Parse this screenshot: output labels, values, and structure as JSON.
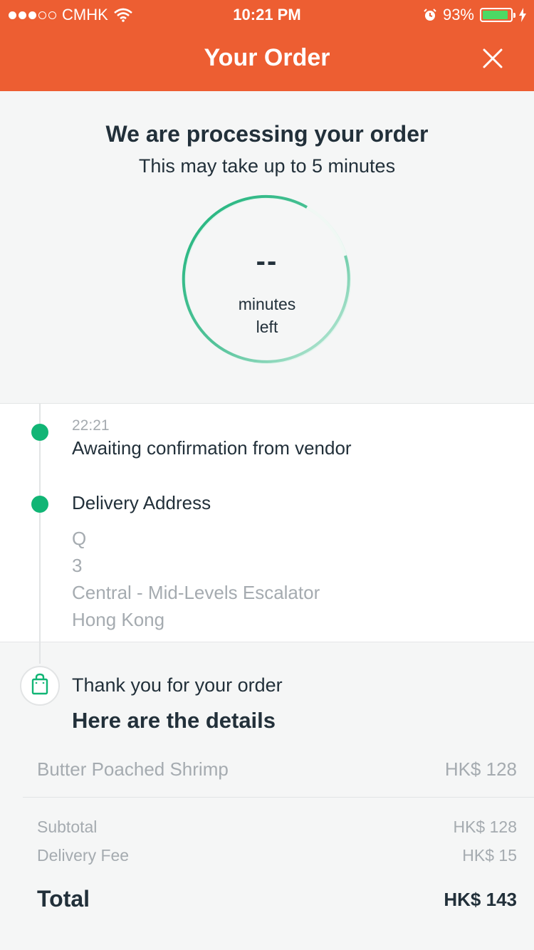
{
  "status_bar": {
    "carrier": "CMHK",
    "time": "10:21 PM",
    "battery_percent": "93%",
    "battery_level": 0.93,
    "signal_bars": 3,
    "signal_total": 5
  },
  "header": {
    "title": "Your Order",
    "background": "#ed5e32"
  },
  "processing": {
    "title": "We are processing your order",
    "subtitle": "This may take up to 5 minutes",
    "countdown_value": "--",
    "countdown_label_line1": "minutes",
    "countdown_label_line2": "left",
    "accent": "#1fb57d"
  },
  "timeline": {
    "events": [
      {
        "time": "22:21",
        "text": "Awaiting confirmation from vendor"
      }
    ],
    "delivery_address": {
      "label": "Delivery Address",
      "lines": [
        "Q",
        "3",
        "Central - Mid-Levels Escalator",
        "Hong Kong"
      ]
    }
  },
  "details": {
    "thanks": "Thank you for your order",
    "title": "Here are the details",
    "items": [
      {
        "name": "Butter Poached Shrimp",
        "price": "HK$ 128"
      }
    ],
    "subtotal_label": "Subtotal",
    "subtotal_value": "HK$ 128",
    "delivery_fee_label": "Delivery Fee",
    "delivery_fee_value": "HK$ 15",
    "total_label": "Total",
    "total_value": "HK$ 143"
  }
}
